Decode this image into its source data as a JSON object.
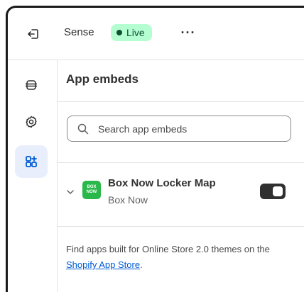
{
  "header": {
    "theme_name": "Sense",
    "status_badge": "Live",
    "more_label": "···"
  },
  "sidebar": {
    "items": [
      {
        "icon": "sections-icon",
        "active": false
      },
      {
        "icon": "gear-icon",
        "active": false
      },
      {
        "icon": "app-embeds-icon",
        "active": true
      }
    ]
  },
  "panel": {
    "title": "App embeds",
    "search": {
      "placeholder": "Search app embeds",
      "value": ""
    },
    "embeds": [
      {
        "name": "Box Now Locker Map",
        "vendor": "Box Now",
        "logo_text_top": "BOX",
        "logo_text_bottom": "NOW",
        "enabled": true
      }
    ],
    "footer": {
      "text_before": "Find apps built for Online Store 2.0 themes on the ",
      "link": "Shopify App Store",
      "text_after": "."
    }
  },
  "colors": {
    "badge_bg": "#b4fed2",
    "badge_text": "#0c5132",
    "active_nav_bg": "#e8eefc",
    "link": "#005bd3",
    "app_logo": "#2bb84a"
  }
}
